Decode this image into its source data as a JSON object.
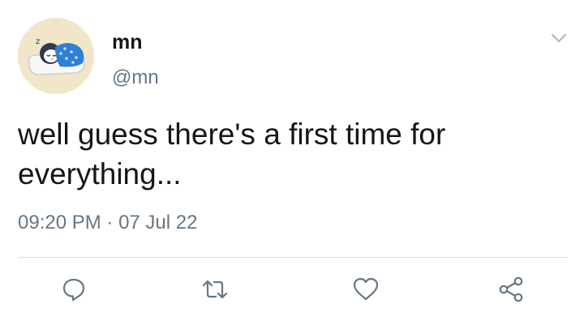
{
  "user": {
    "display_name": "mn",
    "handle": "@mn",
    "avatar_icon": "sleeping-penguin-avatar"
  },
  "tweet": {
    "text": "well guess there's a first time for\neverything...",
    "time": "09:20 PM",
    "separator": " · ",
    "date": "07 Jul 22"
  },
  "actions": {
    "reply_icon": "comment-icon",
    "retweet_icon": "retweet-icon",
    "like_icon": "heart-icon",
    "share_icon": "share-icon",
    "menu_icon": "chevron-down-icon"
  },
  "colors": {
    "text": "#14171a",
    "secondary": "#657786",
    "divider": "#d9dfe3",
    "avatar_bg": "#f1e6c8",
    "blanket": "#2f7fd8"
  }
}
